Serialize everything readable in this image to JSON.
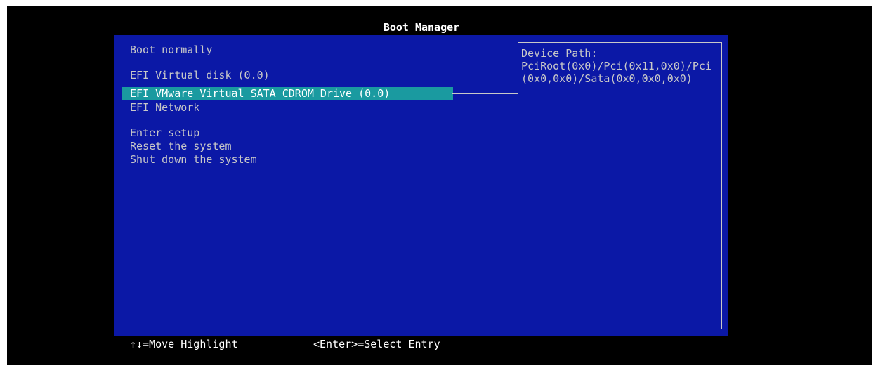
{
  "title": "Boot Manager",
  "menu": {
    "items": [
      {
        "label": "Boot normally"
      },
      {
        "label": "EFI Virtual disk (0.0)"
      },
      {
        "label": "EFI VMware Virtual SATA CDROM Drive (0.0)",
        "selected": true
      },
      {
        "label": "EFI Network"
      },
      {
        "label": "Enter setup"
      },
      {
        "label": "Reset the system"
      },
      {
        "label": "Shut down the system"
      }
    ]
  },
  "help": {
    "heading": "Device Path:",
    "path": "PciRoot(0x0)/Pci(0x11,0x0)/Pci(0x0,0x0)/Sata(0x0,0x0,0x0)"
  },
  "footer": {
    "move_hint": "↑↓=Move Highlight",
    "select_hint": "<Enter>=Select Entry"
  },
  "colors": {
    "panel_bg": "#0b18a6",
    "highlight_bg": "#1a9aa0",
    "text": "#c8c8c8",
    "title_text": "#ffffff"
  }
}
